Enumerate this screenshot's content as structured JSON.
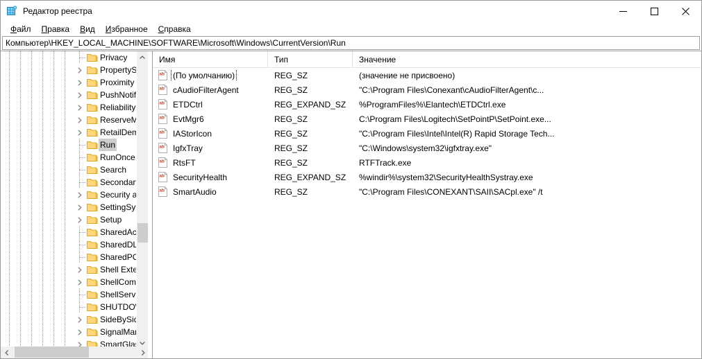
{
  "window": {
    "title": "Редактор реестра",
    "icon": "registry-editor-icon",
    "controls": {
      "minimize": "minimize-icon",
      "maximize": "maximize-icon",
      "close": "close-icon"
    }
  },
  "menu": {
    "items": [
      {
        "accel": "Ф",
        "rest": "айл"
      },
      {
        "accel": "П",
        "rest": "равка"
      },
      {
        "accel": "В",
        "rest": "ид"
      },
      {
        "accel": "И",
        "rest": "збранное"
      },
      {
        "accel": "С",
        "rest": "правка"
      }
    ]
  },
  "address": {
    "path": "Компьютер\\HKEY_LOCAL_MACHINE\\SOFTWARE\\Microsoft\\Windows\\CurrentVersion\\Run"
  },
  "tree": {
    "items": [
      {
        "label": "Privacy",
        "expander": "none",
        "indent": 108
      },
      {
        "label": "PropertySystem",
        "expander": "collapsed",
        "indent": 108
      },
      {
        "label": "Proximity",
        "expander": "collapsed",
        "indent": 108
      },
      {
        "label": "PushNotifications",
        "expander": "collapsed",
        "indent": 108
      },
      {
        "label": "Reliability",
        "expander": "collapsed",
        "indent": 108
      },
      {
        "label": "ReserveManager",
        "expander": "collapsed",
        "indent": 108
      },
      {
        "label": "RetailDemo",
        "expander": "collapsed",
        "indent": 108
      },
      {
        "label": "Run",
        "expander": "none",
        "indent": 108,
        "selected": true
      },
      {
        "label": "RunOnce",
        "expander": "none",
        "indent": 108
      },
      {
        "label": "Search",
        "expander": "none",
        "indent": 108
      },
      {
        "label": "SecondaryAuthFactor",
        "expander": "none",
        "indent": 108
      },
      {
        "label": "Security and Maintenance",
        "expander": "collapsed",
        "indent": 108
      },
      {
        "label": "SettingSync",
        "expander": "collapsed",
        "indent": 108
      },
      {
        "label": "Setup",
        "expander": "collapsed",
        "indent": 108
      },
      {
        "label": "SharedAccess",
        "expander": "none",
        "indent": 108
      },
      {
        "label": "SharedDLLs",
        "expander": "none",
        "indent": 108
      },
      {
        "label": "SharedPC",
        "expander": "none",
        "indent": 108
      },
      {
        "label": "Shell Extensions",
        "expander": "collapsed",
        "indent": 108
      },
      {
        "label": "ShellCompatibility",
        "expander": "collapsed",
        "indent": 108
      },
      {
        "label": "ShellServiceObjectDelayLoad",
        "expander": "none",
        "indent": 108
      },
      {
        "label": "SHUTDOWN",
        "expander": "none",
        "indent": 108
      },
      {
        "label": "SideBySide",
        "expander": "collapsed",
        "indent": 108
      },
      {
        "label": "SignalManager",
        "expander": "collapsed",
        "indent": 108
      },
      {
        "label": "SmartGlass",
        "expander": "collapsed",
        "indent": 108
      }
    ],
    "guides": [
      12,
      28,
      44,
      60,
      76,
      92
    ]
  },
  "list": {
    "columns": [
      {
        "label": "Имя"
      },
      {
        "label": "Тип"
      },
      {
        "label": "Значение"
      }
    ],
    "rows": [
      {
        "name": "(По умолчанию)",
        "type": "REG_SZ",
        "value": "(значение не присвоено)",
        "icon": "string-value-icon",
        "focused": true
      },
      {
        "name": "cAudioFilterAgent",
        "type": "REG_SZ",
        "value": "\"C:\\Program Files\\Conexant\\cAudioFilterAgent\\c...",
        "icon": "string-value-icon"
      },
      {
        "name": "ETDCtrl",
        "type": "REG_EXPAND_SZ",
        "value": "%ProgramFiles%\\Elantech\\ETDCtrl.exe",
        "icon": "string-value-icon"
      },
      {
        "name": "EvtMgr6",
        "type": "REG_SZ",
        "value": "C:\\Program Files\\Logitech\\SetPointP\\SetPoint.exe...",
        "icon": "string-value-icon"
      },
      {
        "name": "IAStorIcon",
        "type": "REG_SZ",
        "value": "\"C:\\Program Files\\Intel\\Intel(R) Rapid Storage Tech...",
        "icon": "string-value-icon"
      },
      {
        "name": "IgfxTray",
        "type": "REG_SZ",
        "value": "\"C:\\Windows\\system32\\igfxtray.exe\"",
        "icon": "string-value-icon"
      },
      {
        "name": "RtsFT",
        "type": "REG_SZ",
        "value": "RTFTrack.exe",
        "icon": "string-value-icon"
      },
      {
        "name": "SecurityHealth",
        "type": "REG_EXPAND_SZ",
        "value": "%windir%\\system32\\SecurityHealthSystray.exe",
        "icon": "string-value-icon"
      },
      {
        "name": "SmartAudio",
        "type": "REG_SZ",
        "value": "\"C:\\Program Files\\CONEXANT\\SAII\\SACpl.exe\" /t",
        "icon": "string-value-icon"
      }
    ]
  },
  "scrollbars": {
    "tree_vertical": {
      "up": "scroll-up-icon",
      "down": "scroll-down-icon"
    },
    "tree_horizontal": {
      "left": "scroll-left-icon",
      "right": "scroll-right-icon"
    }
  },
  "colors": {
    "folder": "#ffd77a",
    "folder_border": "#e0a828",
    "selection": "#cdcdcd",
    "icon_text": "#d03c20",
    "chrome": "#f0f0f0",
    "border": "#9a9a9a"
  }
}
